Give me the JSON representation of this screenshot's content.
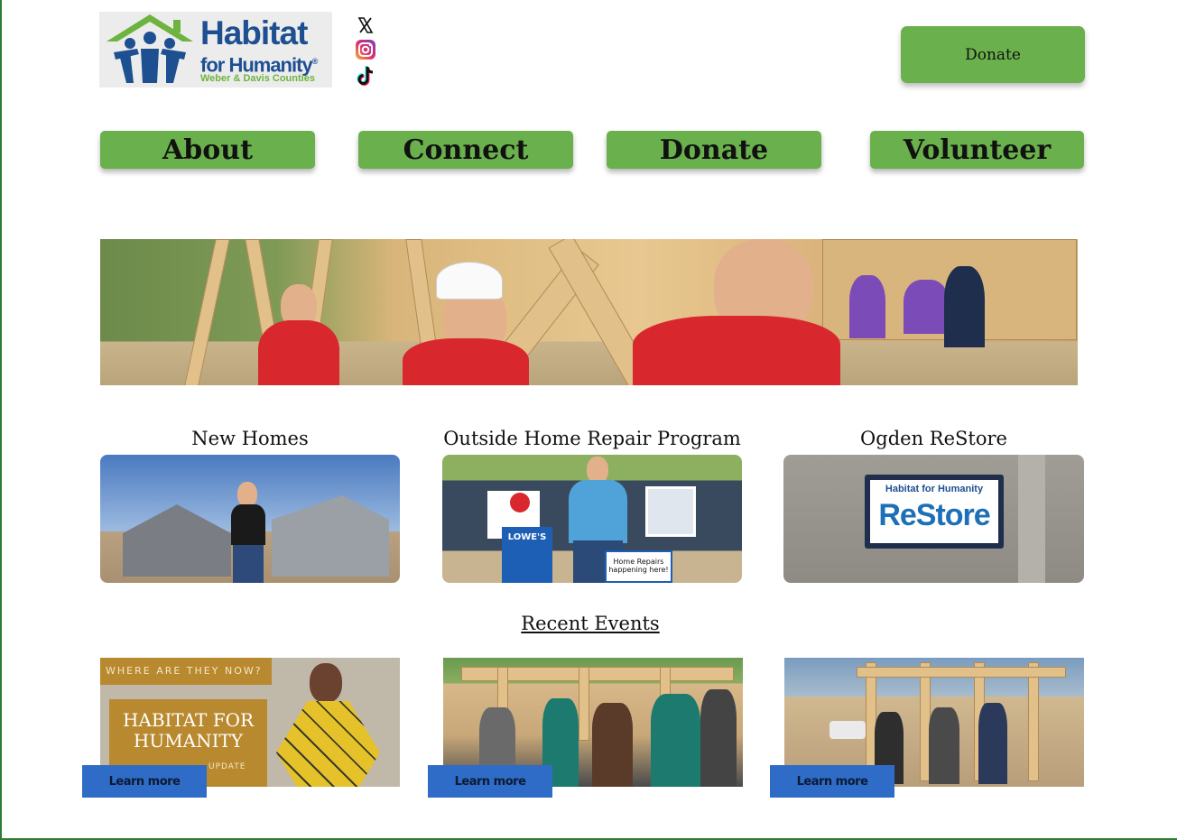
{
  "logo": {
    "line1": "Habitat",
    "line2": "for Humanity",
    "registered": "®",
    "line3": "Weber & Davis Counties"
  },
  "social": {
    "x_icon": "x-icon",
    "instagram_icon": "instagram-icon",
    "tiktok_icon": "tiktok-icon"
  },
  "header": {
    "donate_label": "Donate"
  },
  "nav": {
    "items": [
      {
        "label": "About"
      },
      {
        "label": "Connect"
      },
      {
        "label": "Donate"
      },
      {
        "label": "Volunteer"
      }
    ]
  },
  "features": [
    {
      "title": "New Homes"
    },
    {
      "title": "Outside Home Repair Program"
    },
    {
      "title": "Ogden ReStore"
    }
  ],
  "photo_text": {
    "lowes_sign": "LOWE'S",
    "repair_sign": "Home Repairs happening here!",
    "restore_top": "Habitat for Humanity",
    "restore_main": "ReStore",
    "ev1_kicker": "WHERE ARE THEY NOW?",
    "ev1_title": "HABITAT FOR HUMANITY",
    "ev1_sub": "UPDATE"
  },
  "recent_events": {
    "title": "Recent Events",
    "learn_more_label": "Learn more"
  },
  "colors": {
    "green_button": "#6ab04c",
    "learn_more_blue": "#2f6cc7",
    "logo_blue": "#1d4f91",
    "logo_green": "#6db33f"
  }
}
